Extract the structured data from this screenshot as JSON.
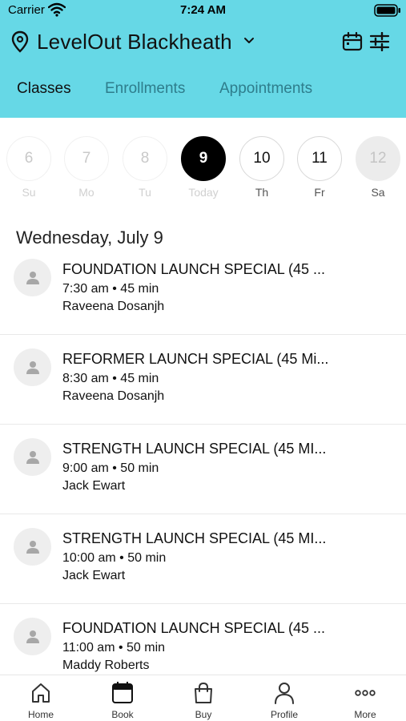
{
  "status_bar": {
    "carrier": "Carrier",
    "time": "7:24 AM"
  },
  "header": {
    "location": "LevelOut Blackheath",
    "background_color": "#66d8e6",
    "tabs": [
      {
        "label": "Classes",
        "active": true
      },
      {
        "label": "Enrollments",
        "active": false
      },
      {
        "label": "Appointments",
        "active": false
      }
    ]
  },
  "date_strip": [
    {
      "num": "6",
      "label": "Su",
      "state": "faded"
    },
    {
      "num": "7",
      "label": "Mo",
      "state": "faded"
    },
    {
      "num": "8",
      "label": "Tu",
      "state": "faded"
    },
    {
      "num": "9",
      "label": "Today",
      "state": "selected"
    },
    {
      "num": "10",
      "label": "Th",
      "state": "normal"
    },
    {
      "num": "11",
      "label": "Fr",
      "state": "normal"
    },
    {
      "num": "12",
      "label": "Sa",
      "state": "shaded"
    }
  ],
  "date_heading": "Wednesday, July 9",
  "classes": [
    {
      "title": "FOUNDATION LAUNCH SPECIAL (45 ...",
      "time": "7:30 am • 45 min",
      "instructor": "Raveena Dosanjh"
    },
    {
      "title": "REFORMER LAUNCH SPECIAL (45 Mi...",
      "time": "8:30 am • 45 min",
      "instructor": "Raveena Dosanjh"
    },
    {
      "title": "STRENGTH LAUNCH SPECIAL (45 MI...",
      "time": "9:00 am • 50 min",
      "instructor": "Jack Ewart"
    },
    {
      "title": "STRENGTH LAUNCH SPECIAL (45 MI...",
      "time": "10:00 am • 50 min",
      "instructor": "Jack Ewart"
    },
    {
      "title": "FOUNDATION LAUNCH SPECIAL (45 ...",
      "time": "11:00 am • 50 min",
      "instructor": "Maddy Roberts"
    }
  ],
  "bottom_nav": [
    {
      "label": "Home",
      "icon": "home-icon"
    },
    {
      "label": "Book",
      "icon": "book-calendar-icon"
    },
    {
      "label": "Buy",
      "icon": "shopping-bag-icon"
    },
    {
      "label": "Profile",
      "icon": "person-icon"
    },
    {
      "label": "More",
      "icon": "more-icon"
    }
  ]
}
